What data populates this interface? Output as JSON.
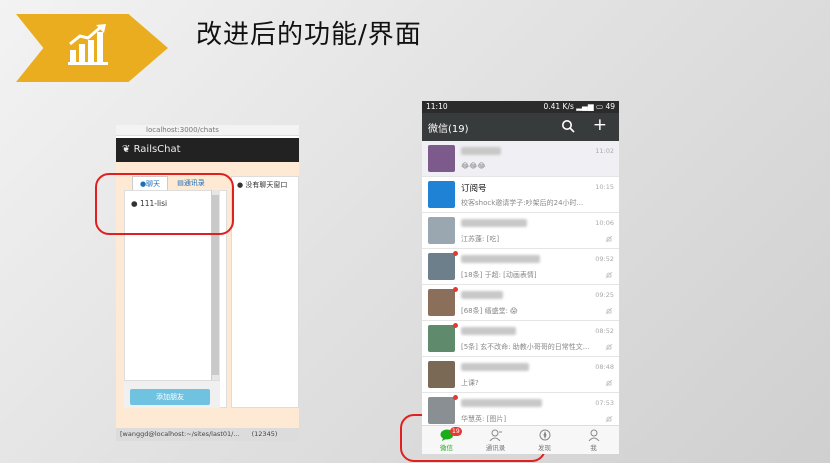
{
  "slide": {
    "title": "改进后的功能/界面"
  },
  "browser": {
    "address": "localhost:3000/chats",
    "app_name": "RailsChat",
    "tabs": [
      "聊天",
      "通讯录"
    ],
    "conversations": [
      "111-lisi"
    ],
    "no_window_label": "没有聊天窗口",
    "add_friend_label": "添加朋友",
    "terminal_items": [
      "[wanggd@localhost:~/sites/last01/...",
      "(12345)"
    ]
  },
  "phone": {
    "status": {
      "time": "11:10",
      "speed": "0.41 K/s",
      "battery": "49"
    },
    "header_title": "微信(19)",
    "chats": [
      {
        "name": "",
        "message": "😂😂😂",
        "time": "11:02",
        "muted": false,
        "unread_dot": false,
        "avatar_color": "#7d5a8c"
      },
      {
        "name": "订阅号",
        "message": "校客shock邀请学子:吵架后的24小时...",
        "time": "10:15",
        "muted": false,
        "unread_dot": false,
        "avatar_color": "#1f82d5"
      },
      {
        "name": "",
        "message": "江苏蓬: [吃]",
        "time": "10:06",
        "muted": true,
        "unread_dot": false,
        "avatar_color": "#9aa7b1"
      },
      {
        "name": "",
        "message": "[18条] 于超: [动画表情]",
        "time": "09:52",
        "muted": true,
        "unread_dot": true,
        "avatar_color": "#6d7f8a"
      },
      {
        "name": "",
        "message": "[68条] 缙盛堂: 😱",
        "time": "09:25",
        "muted": true,
        "unread_dot": true,
        "avatar_color": "#8c6f5a"
      },
      {
        "name": "",
        "message": "[5条] 玄不改命: 助教小哥哥的日常性文...",
        "time": "08:52",
        "muted": true,
        "unread_dot": true,
        "avatar_color": "#5f8a6c"
      },
      {
        "name": "",
        "message": "上课?",
        "time": "08:48",
        "muted": true,
        "unread_dot": false,
        "avatar_color": "#7a6a55"
      },
      {
        "name": "",
        "message": "华慧英: [图片]",
        "time": "07:53",
        "muted": true,
        "unread_dot": true,
        "avatar_color": "#8a8f94"
      }
    ],
    "nav": [
      {
        "label": "微信",
        "icon": "chat-icon",
        "badge": "19"
      },
      {
        "label": "通讯录",
        "icon": "contacts-icon"
      },
      {
        "label": "发现",
        "icon": "discover-icon"
      },
      {
        "label": "我",
        "icon": "me-icon"
      }
    ]
  },
  "colors": {
    "accent": "#e9ad1f",
    "wechat_green": "#1aad19",
    "highlight_red": "#e02020"
  }
}
